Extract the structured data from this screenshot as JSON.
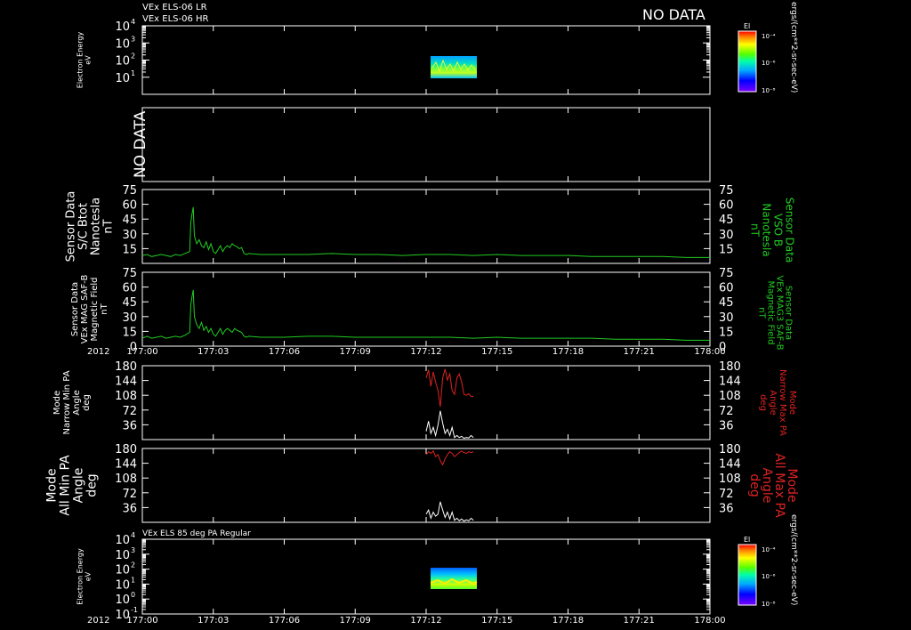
{
  "header": {
    "line1": "VEx ELS-06 LR",
    "line2": "VEx ELS-06 HR",
    "no_data": "NO DATA"
  },
  "panel2": {
    "no_data": "NO DATA"
  },
  "colorbar_units": "ergs/(cm**2-sr-sec-eV)",
  "colorbar": {
    "label": "El",
    "ticks": [
      "10⁻⁴",
      "10⁻⁶",
      "10⁻⁸"
    ]
  },
  "time_axis": {
    "year": "2012",
    "ticks": [
      "177:00",
      "177:03",
      "177:06",
      "177:09",
      "177:12",
      "177:15",
      "177:18",
      "177:21",
      "178:00"
    ]
  },
  "mid_title": "VEx ELS 85 deg PA Regular",
  "colors": {
    "green": "#22cc22",
    "red": "#dd2222",
    "white": "#ffffff",
    "frame": "#ffffff"
  },
  "chart_data": [
    {
      "type": "heatmap",
      "ylabel": [
        "Electron Energy",
        "eV"
      ],
      "ylog": true,
      "ylim": [
        1,
        10000
      ],
      "yticks": [
        {
          "base": "10",
          "exp": "4",
          "v": 10000
        },
        {
          "base": "10",
          "exp": "3",
          "v": 1000
        },
        {
          "base": "10",
          "exp": "2",
          "v": 100
        },
        {
          "base": "10",
          "exp": "1",
          "v": 10
        }
      ],
      "data_time_range": [
        "177:12",
        "177:14"
      ],
      "energy_range": [
        8,
        200
      ]
    },
    {
      "type": "line",
      "ylabel": [
        "Sensor Data",
        "S/C Btot",
        "Nanotesla",
        "nT"
      ],
      "ylabel_right": [
        "Sensor Data",
        "VSO B",
        "Nanotesla",
        "nT"
      ],
      "ylim": [
        0,
        75
      ],
      "yticks": [
        "75",
        "60",
        "45",
        "30",
        "15"
      ],
      "x_minutes": [
        0,
        0.2,
        0.4,
        0.6,
        0.8,
        1.0,
        1.2,
        1.4,
        1.6,
        1.8,
        2.0,
        2.05,
        2.1,
        2.15,
        2.2,
        2.3,
        2.4,
        2.5,
        2.6,
        2.7,
        2.8,
        2.9,
        3.0,
        3.1,
        3.2,
        3.3,
        3.4,
        3.5,
        3.6,
        3.7,
        3.8,
        3.9,
        4.0,
        4.1,
        4.2,
        4.3,
        4.4,
        4.5,
        5,
        6,
        7,
        8,
        9,
        10,
        11,
        12,
        13,
        14,
        15,
        16,
        17,
        18,
        19,
        20,
        21,
        22,
        23,
        24
      ],
      "values": [
        8,
        9,
        7,
        8,
        9,
        8,
        7,
        9,
        8,
        10,
        12,
        42,
        50,
        57,
        28,
        20,
        24,
        18,
        16,
        22,
        14,
        20,
        12,
        10,
        14,
        18,
        12,
        16,
        18,
        16,
        20,
        18,
        17,
        15,
        16,
        10,
        9,
        10,
        9,
        9,
        9,
        10,
        9,
        9,
        8,
        9,
        9,
        8,
        9,
        8,
        8,
        8,
        7,
        7,
        7,
        7,
        6,
        6
      ]
    },
    {
      "type": "line",
      "ylabel": [
        "Sensor Data",
        "VEx MAG SAF-B",
        "Magnetic Field",
        "nT"
      ],
      "ylabel_right": [
        "Sensor Data",
        "VEx MAG3 SAF-B",
        "Magnetic Field",
        "nT"
      ],
      "ylim": [
        0,
        75
      ],
      "yticks": [
        "75",
        "60",
        "45",
        "30",
        "15",
        "0"
      ],
      "x_minutes": [
        0,
        0.2,
        0.4,
        0.6,
        0.8,
        1.0,
        1.2,
        1.4,
        1.6,
        1.8,
        2.0,
        2.05,
        2.1,
        2.15,
        2.2,
        2.3,
        2.4,
        2.5,
        2.6,
        2.7,
        2.8,
        2.9,
        3.0,
        3.1,
        3.2,
        3.3,
        3.4,
        3.5,
        3.6,
        3.7,
        3.8,
        3.9,
        4.0,
        4.1,
        4.2,
        4.3,
        4.4,
        4.5,
        5,
        6,
        7,
        8,
        9,
        10,
        11,
        12,
        13,
        14,
        15,
        16,
        17,
        18,
        19,
        20,
        21,
        22,
        23,
        24
      ],
      "values": [
        8,
        10,
        8,
        9,
        10,
        8,
        9,
        10,
        9,
        11,
        14,
        42,
        50,
        57,
        30,
        22,
        18,
        24,
        16,
        20,
        14,
        18,
        12,
        10,
        14,
        18,
        12,
        16,
        18,
        16,
        14,
        18,
        16,
        15,
        14,
        10,
        9,
        10,
        9,
        9,
        10,
        10,
        9,
        9,
        9,
        9,
        9,
        8,
        9,
        8,
        8,
        8,
        8,
        7,
        7,
        7,
        6,
        6
      ]
    },
    {
      "type": "line",
      "ylabel": [
        "Mode",
        "Narrow Min PA",
        "Angle",
        "deg"
      ],
      "ylabel_right": [
        "Mode",
        "Narrow Max PA",
        "Angle",
        "deg"
      ],
      "ylim": [
        0,
        180
      ],
      "yticks": [
        "180",
        "144",
        "108",
        "72",
        "36"
      ],
      "series": [
        {
          "color": "red",
          "x_minutes": [
            12.0,
            12.1,
            12.2,
            12.3,
            12.4,
            12.5,
            12.6,
            12.7,
            12.8,
            12.9,
            13.0,
            13.1,
            13.2,
            13.3,
            13.4,
            13.5,
            13.6,
            13.7,
            13.8,
            13.9,
            14.0
          ],
          "values": [
            150,
            170,
            130,
            165,
            140,
            120,
            80,
            150,
            172,
            145,
            160,
            120,
            110,
            150,
            160,
            140,
            110,
            108,
            112,
            105,
            105
          ]
        },
        {
          "color": "white",
          "x_minutes": [
            12.0,
            12.1,
            12.2,
            12.3,
            12.4,
            12.5,
            12.6,
            12.7,
            12.8,
            12.9,
            13.0,
            13.1,
            13.2,
            13.3,
            13.4,
            13.5,
            13.6,
            13.7,
            13.8,
            13.9,
            14.0
          ],
          "values": [
            20,
            45,
            15,
            30,
            10,
            35,
            70,
            40,
            15,
            25,
            10,
            30,
            5,
            10,
            5,
            8,
            3,
            5,
            4,
            10,
            5
          ]
        }
      ]
    },
    {
      "type": "line",
      "ylabel": [
        "Mode",
        "All Min PA",
        "Angle",
        "deg"
      ],
      "ylabel_right": [
        "Mode",
        "All Max PA",
        "Angle",
        "deg"
      ],
      "ylim": [
        0,
        180
      ],
      "yticks": [
        "180",
        "144",
        "108",
        "72",
        "36"
      ],
      "series": [
        {
          "color": "red",
          "x_minutes": [
            12.0,
            12.1,
            12.2,
            12.3,
            12.4,
            12.5,
            12.6,
            12.7,
            12.8,
            12.9,
            13.0,
            13.1,
            13.2,
            13.3,
            13.4,
            13.5,
            13.6,
            13.7,
            13.8,
            13.9,
            14.0
          ],
          "values": [
            165,
            172,
            168,
            174,
            160,
            165,
            150,
            140,
            155,
            165,
            172,
            168,
            160,
            165,
            170,
            174,
            170,
            168,
            172,
            170,
            172
          ]
        },
        {
          "color": "white",
          "x_minutes": [
            12.0,
            12.1,
            12.2,
            12.3,
            12.4,
            12.5,
            12.6,
            12.7,
            12.8,
            12.9,
            13.0,
            13.1,
            13.2,
            13.3,
            13.4,
            13.5,
            13.6,
            13.7,
            13.8,
            13.9,
            14.0
          ],
          "values": [
            20,
            30,
            10,
            25,
            15,
            20,
            50,
            30,
            12,
            25,
            8,
            25,
            5,
            10,
            4,
            8,
            3,
            6,
            4,
            10,
            5
          ]
        }
      ]
    },
    {
      "type": "heatmap",
      "ylabel": [
        "Electron Energy",
        "eV"
      ],
      "ylog": true,
      "ylim": [
        0.1,
        10000
      ],
      "yticks": [
        {
          "base": "10",
          "exp": "4",
          "v": 10000
        },
        {
          "base": "10",
          "exp": "3",
          "v": 1000
        },
        {
          "base": "10",
          "exp": "2",
          "v": 100
        },
        {
          "base": "10",
          "exp": "1",
          "v": 10
        },
        {
          "base": "10",
          "exp": "0",
          "v": 1
        },
        {
          "base": "10",
          "exp": "-1",
          "v": 0.1
        }
      ],
      "data_time_range": [
        "177:12",
        "177:14"
      ],
      "energy_range": [
        3,
        200
      ]
    }
  ]
}
